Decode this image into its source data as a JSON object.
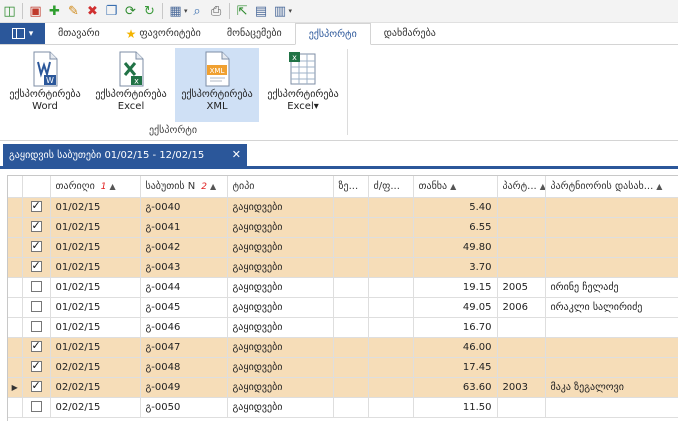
{
  "qat": {
    "icons": [
      {
        "name": "app-icon",
        "glyph": "◫",
        "color": "#2e8b2e"
      },
      {
        "name": "new-window-icon",
        "glyph": "▣",
        "color": "#c0392b"
      },
      {
        "name": "add-icon",
        "glyph": "✚",
        "color": "#2e9e2e"
      },
      {
        "name": "edit-icon",
        "glyph": "✎",
        "color": "#d08a1a"
      },
      {
        "name": "delete-icon",
        "glyph": "✖",
        "color": "#d03030"
      },
      {
        "name": "copy-icon",
        "glyph": "❐",
        "color": "#3a6fb0"
      },
      {
        "name": "refresh-doc-icon",
        "glyph": "⟳",
        "color": "#2e8b2e"
      },
      {
        "name": "refresh-icon",
        "glyph": "↻",
        "color": "#3a9a3a"
      },
      {
        "name": "grid-options-icon",
        "glyph": "▦",
        "color": "#4b6a9a"
      },
      {
        "name": "preview-icon",
        "glyph": "⌕",
        "color": "#3a6fb0"
      },
      {
        "name": "print-icon",
        "glyph": "⎙",
        "color": "#555555"
      },
      {
        "name": "export-icon",
        "glyph": "⇱",
        "color": "#2e8b2e"
      },
      {
        "name": "save-layout-icon",
        "glyph": "▤",
        "color": "#4b6a9a"
      },
      {
        "name": "layout-icon",
        "glyph": "▥",
        "color": "#4b6a9a"
      }
    ]
  },
  "tabs": {
    "items": [
      "მთავარი",
      "ფავორიტები",
      "მონაცემები",
      "ექსპორტი",
      "დახმარება"
    ],
    "active_index": 3
  },
  "ribbon": {
    "group_label": "ექსპორტი",
    "buttons": [
      {
        "line1": "ექსპორტირება",
        "line2": "Word"
      },
      {
        "line1": "ექსპორტირება",
        "line2": "Excel"
      },
      {
        "line1": "ექსპორტირება",
        "line2": "XML"
      },
      {
        "line1": "ექსპორტირება",
        "line2": "Excel▾"
      }
    ],
    "selected_index": 2
  },
  "doc_tab": {
    "title": "გაყიდვის საბუთები 01/02/15 - 12/02/15",
    "close": "✕"
  },
  "grid": {
    "headers": [
      {
        "label": "თარიღი",
        "sort_num": "1",
        "sort": "▲"
      },
      {
        "label": "საბუთის N",
        "sort_num": "2",
        "sort": "▲"
      },
      {
        "label": "ტიპი"
      },
      {
        "label": "ზე..."
      },
      {
        "label": "ძ/ფ..."
      },
      {
        "label": "თანხა",
        "sort": "▲"
      },
      {
        "label": "პარტ...",
        "sort": "▲"
      },
      {
        "label": "პარტნიორის დასახ...",
        "sort": "▲"
      }
    ],
    "rows": [
      {
        "checked": true,
        "hl": true,
        "date": "01/02/15",
        "num": "გ-0040",
        "type": "გაყიდვები",
        "amount": "5.40",
        "pcode": "",
        "pname": ""
      },
      {
        "checked": true,
        "hl": true,
        "date": "01/02/15",
        "num": "გ-0041",
        "type": "გაყიდვები",
        "amount": "6.55",
        "pcode": "",
        "pname": ""
      },
      {
        "checked": true,
        "hl": true,
        "date": "01/02/15",
        "num": "გ-0042",
        "type": "გაყიდვები",
        "amount": "49.80",
        "pcode": "",
        "pname": ""
      },
      {
        "checked": true,
        "hl": true,
        "date": "01/02/15",
        "num": "გ-0043",
        "type": "გაყიდვები",
        "amount": "3.70",
        "pcode": "",
        "pname": ""
      },
      {
        "checked": false,
        "hl": false,
        "date": "01/02/15",
        "num": "გ-0044",
        "type": "გაყიდვები",
        "amount": "19.15",
        "pcode": "2005",
        "pname": "ირინე ჩელაძე"
      },
      {
        "checked": false,
        "hl": false,
        "date": "01/02/15",
        "num": "გ-0045",
        "type": "გაყიდვები",
        "amount": "49.05",
        "pcode": "2006",
        "pname": "ირაკლი სალირიძე"
      },
      {
        "checked": false,
        "hl": false,
        "date": "01/02/15",
        "num": "გ-0046",
        "type": "გაყიდვები",
        "amount": "16.70",
        "pcode": "",
        "pname": ""
      },
      {
        "checked": true,
        "hl": true,
        "date": "01/02/15",
        "num": "გ-0047",
        "type": "გაყიდვები",
        "amount": "46.00",
        "pcode": "",
        "pname": ""
      },
      {
        "checked": true,
        "hl": true,
        "date": "02/02/15",
        "num": "გ-0048",
        "type": "გაყიდვები",
        "amount": "17.45",
        "pcode": "",
        "pname": ""
      },
      {
        "checked": true,
        "hl": true,
        "current": true,
        "date": "02/02/15",
        "num": "გ-0049",
        "type": "გაყიდვები",
        "amount": "63.60",
        "pcode": "2003",
        "pname": "მაკა ზეგალოვი"
      },
      {
        "checked": false,
        "hl": false,
        "date": "02/02/15",
        "num": "გ-0050",
        "type": "გაყიდვები",
        "amount": "11.50",
        "pcode": "",
        "pname": ""
      }
    ]
  }
}
